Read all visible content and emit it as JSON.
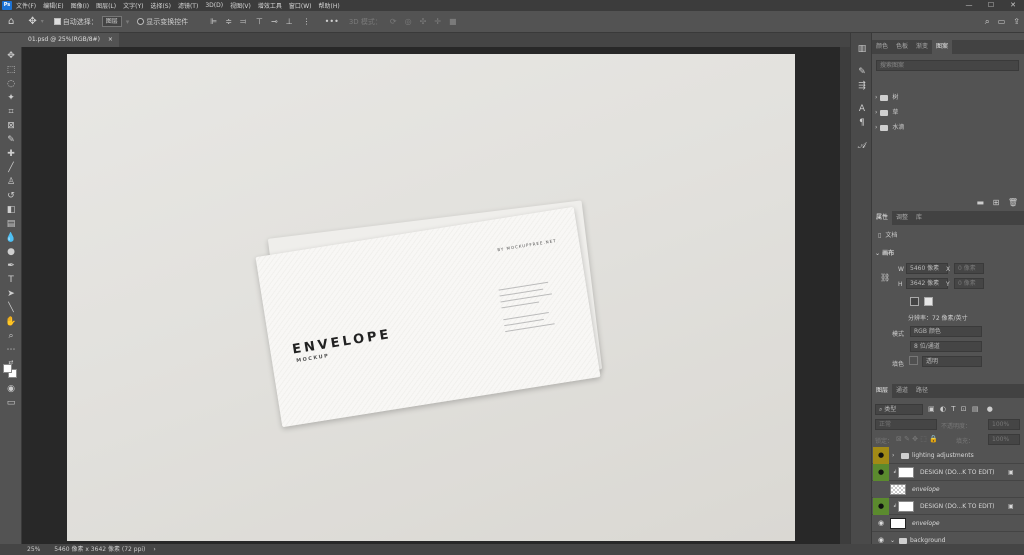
{
  "app_logo": "Ps",
  "menu": [
    "文件(F)",
    "编辑(E)",
    "图像(I)",
    "图层(L)",
    "文字(Y)",
    "选择(S)",
    "滤镜(T)",
    "3D(D)",
    "视图(V)",
    "增效工具",
    "窗口(W)",
    "帮助(H)"
  ],
  "window_controls": [
    "—",
    "☐",
    "✕"
  ],
  "options": {
    "auto_select_label": "自动选择：",
    "auto_select_value": "图层",
    "transform_label": "显示变换控件",
    "more": "•••",
    "mode_3d": "3D 模式："
  },
  "doc_tab": {
    "title": "01.psd @ 25%(RGB/8#)",
    "close": "×"
  },
  "envelope": {
    "title": "ENVELOPE",
    "subtitle": "MOCKUP",
    "byline": "BY MOCKUPFREE.NET"
  },
  "panel_top": {
    "tabs": [
      "颜色",
      "色板",
      "渐变",
      "图案"
    ],
    "search_placeholder": "搜索图案",
    "items": [
      "树",
      "草",
      "水滴"
    ]
  },
  "properties": {
    "tabs": [
      "属性",
      "调整",
      "库"
    ],
    "doc_label": "文档",
    "canvas_label": "画布",
    "w_label": "W",
    "w_value": "5460 像素",
    "h_label": "H",
    "h_value": "3642 像素",
    "x_label": "X",
    "x_value": "0 像素",
    "y_label": "Y",
    "y_value": "0 像素",
    "resolution": "分辨率：72 像素/英寸",
    "mode_label": "模式",
    "mode_value": "RGB 颜色",
    "depth_value": "8 位/通道",
    "fill_label": "填色",
    "fill_value": "透明"
  },
  "layers_panel": {
    "tabs": [
      "图层",
      "通道",
      "路径"
    ],
    "filter_label": "类型",
    "blend_mode": "正常",
    "opacity_label": "不透明度：",
    "opacity_value": "100%",
    "lock_label": "锁定：",
    "fill_label": "填充：",
    "fill_value": "100%",
    "layers": [
      {
        "name": "lighting adjustments",
        "eye": "yellow",
        "type": "group"
      },
      {
        "name": "DESIGN (DO...K TO EDIT)",
        "eye": "green",
        "type": "smart"
      },
      {
        "name": "envelope",
        "eye": "none",
        "type": "layer"
      },
      {
        "name": "DESIGN (DO...K TO EDIT)",
        "eye": "green",
        "type": "smart"
      },
      {
        "name": "envelope",
        "eye": "gray",
        "type": "layer"
      },
      {
        "name": "background",
        "eye": "gray",
        "type": "group"
      }
    ]
  },
  "status": {
    "zoom": "25%",
    "size": "5460 像素 x 3642 像素 (72 ppi)",
    "arrow": "›"
  },
  "colors": {
    "yellow_eye": "#a28a16",
    "green_eye": "#5b8a2e",
    "gray_eye": "#5a5a5a"
  }
}
